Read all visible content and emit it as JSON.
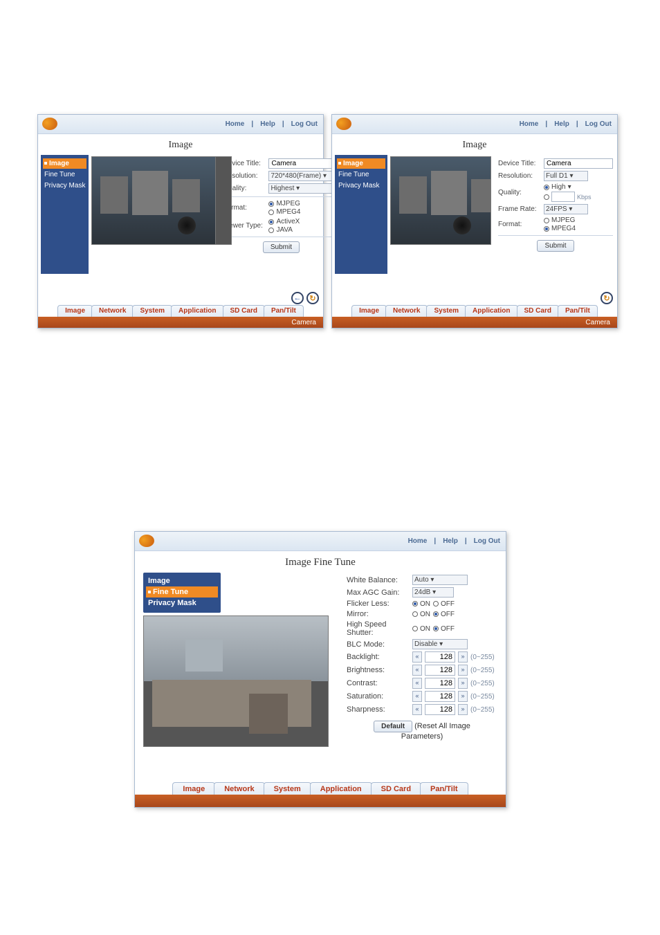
{
  "header": {
    "links": [
      "Home",
      "Help",
      "Log Out"
    ]
  },
  "tabs": [
    "Image",
    "Network",
    "System",
    "Application",
    "SD Card",
    "Pan/Tilt"
  ],
  "footer_label": "Camera",
  "top_left": {
    "title": "Image",
    "sidebar": [
      "Image",
      "Fine Tune",
      "Privacy Mask"
    ],
    "sidebar_active": 0,
    "fields": {
      "device_title_label": "Device Title:",
      "device_title_value": "Camera",
      "resolution_label": "Resolution:",
      "resolution_value": "720*480(Frame)",
      "quality_label": "Quality:",
      "quality_value": "Highest",
      "format_label": "Format:",
      "format_opts": [
        "MJPEG",
        "MPEG4"
      ],
      "format_sel": 0,
      "viewer_label": "Viewer Type:",
      "viewer_opts": [
        "ActiveX",
        "JAVA"
      ],
      "viewer_sel": 0,
      "submit": "Submit"
    }
  },
  "top_right": {
    "title": "Image",
    "sidebar": [
      "Image",
      "Fine Tune",
      "Privacy Mask"
    ],
    "sidebar_active": 0,
    "fields": {
      "device_title_label": "Device Title:",
      "device_title_value": "Camera",
      "resolution_label": "Resolution:",
      "resolution_value": "Full D1",
      "quality_label": "Quality:",
      "quality_value": "High",
      "quality_hint": "Kbps",
      "framerate_label": "Frame Rate:",
      "framerate_value": "24FPS",
      "format_label": "Format:",
      "format_opts": [
        "MJPEG",
        "MPEG4"
      ],
      "format_sel": 1,
      "submit": "Submit"
    }
  },
  "bottom": {
    "title": "Image Fine Tune",
    "sidebar": [
      "Image",
      "Fine Tune",
      "Privacy Mask"
    ],
    "sidebar_active": 1,
    "fields": {
      "wb_label": "White Balance:",
      "wb_value": "Auto",
      "agc_label": "Max AGC Gain:",
      "agc_value": "24dB",
      "flicker_label": "Flicker Less:",
      "flicker_sel": 0,
      "onoff": [
        "ON",
        "OFF"
      ],
      "mirror_label": "Mirror:",
      "mirror_sel": 1,
      "shutter_label": "High Speed Shutter:",
      "shutter_sel": 1,
      "blc_label": "BLC Mode:",
      "blc_value": "Disable",
      "backlight_label": "Backlight:",
      "backlight_value": "128",
      "brightness_label": "Brightness:",
      "brightness_value": "128",
      "contrast_label": "Contrast:",
      "contrast_value": "128",
      "saturation_label": "Saturation:",
      "saturation_value": "128",
      "sharpness_label": "Sharpness:",
      "sharpness_value": "128",
      "range_hint": "(0~255)",
      "default_btn": "Default",
      "reset_text": "(Reset All Image",
      "params_text": "Parameters)"
    }
  }
}
